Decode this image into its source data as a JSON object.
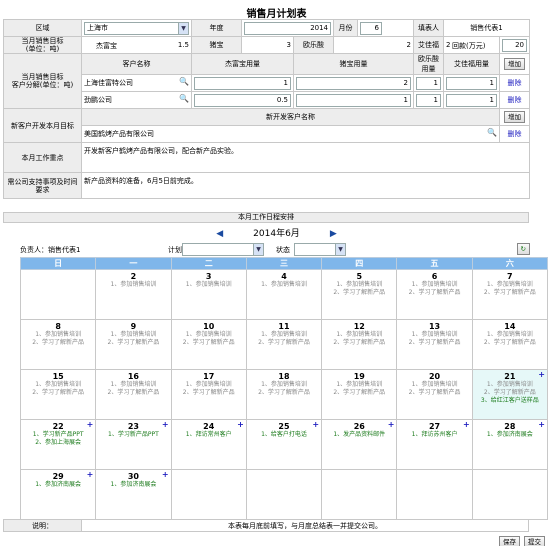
{
  "title": "销售月计划表",
  "form": {
    "region_label": "区域",
    "region_value": "上海市",
    "year_label": "年度",
    "year_value": "2014",
    "month_label": "月份",
    "month_value": "6",
    "reporter_label": "填表人",
    "reporter_value": "销售代表1",
    "target_label": "当月销售目标\n(单位：吨)",
    "products": [
      {
        "name": "杰富宝",
        "value": "1.5"
      },
      {
        "name": "猪宝",
        "value": "3"
      },
      {
        "name": "欧乐酸",
        "value": "2"
      },
      {
        "name": "艾佳福",
        "value": "2"
      }
    ],
    "payment_label": "回款(万元)",
    "payment_value": "20",
    "breakdown_label": "当月销售目标\n客户分解(单位：吨)",
    "breakdown_headers": [
      "客户名称",
      "杰富宝用量",
      "猪宝用量",
      "欧乐酸用量",
      "艾佳福用量"
    ],
    "add_label": "增加",
    "delete_label": "删除",
    "customers": [
      {
        "name": "上海佳富特公司",
        "v": [
          "1",
          "2",
          "1",
          "1"
        ]
      },
      {
        "name": "劲鹏公司",
        "v": [
          "0.5",
          "1",
          "1",
          "1"
        ]
      }
    ],
    "newcust_label": "新客户开发本月目标",
    "newcust_header": "新开发客户名称",
    "newcust_value": "美国鹤烤产品有限公司",
    "focus_label": "本月工作重点",
    "focus_value": "开发新客户鹤烤产品有限公司，配合新产品实验。",
    "support_label": "需公司支持事项及时间要求",
    "support_value": "新产品资料的准备，6月5日前完成。"
  },
  "schedule": {
    "title": "本月工作日程安排",
    "month": "2014年6月",
    "owner": "负责人：销售代表1",
    "plan_label": "计划",
    "status_label": "状态",
    "weekdays": [
      "日",
      "一",
      "二",
      "三",
      "四",
      "五",
      "六"
    ],
    "weeks": [
      [
        {
          "d": "",
          "e": []
        },
        {
          "d": "2",
          "e": [
            "1、参加销售培训"
          ]
        },
        {
          "d": "3",
          "e": [
            "1、参加销售培训"
          ]
        },
        {
          "d": "4",
          "e": [
            "1、参加销售培训"
          ]
        },
        {
          "d": "5",
          "e": [
            "1、参加销售培训",
            "2、学习了解新产品"
          ]
        },
        {
          "d": "6",
          "e": [
            "1、参加销售培训",
            "2、学习了解新产品"
          ]
        },
        {
          "d": "7",
          "e": [
            "1、参加销售培训",
            "2、学习了解新产品"
          ]
        }
      ],
      [
        {
          "d": "8",
          "e": [
            "1、参加销售培训",
            "2、学习了解新产品"
          ]
        },
        {
          "d": "9",
          "e": [
            "1、参加销售培训",
            "2、学习了解新产品"
          ]
        },
        {
          "d": "10",
          "e": [
            "1、参加销售培训",
            "2、学习了解新产品"
          ]
        },
        {
          "d": "11",
          "e": [
            "1、参加销售培训",
            "2、学习了解新产品"
          ]
        },
        {
          "d": "12",
          "e": [
            "1、参加销售培训",
            "2、学习了解新产品"
          ]
        },
        {
          "d": "13",
          "e": [
            "1、参加销售培训",
            "2、学习了解新产品"
          ]
        },
        {
          "d": "14",
          "e": [
            "1、参加销售培训",
            "2、学习了解新产品"
          ]
        }
      ],
      [
        {
          "d": "15",
          "e": [
            "1、参加销售培训",
            "2、学习了解新产品"
          ]
        },
        {
          "d": "16",
          "e": [
            "1、参加销售培训",
            "2、学习了解新产品"
          ]
        },
        {
          "d": "17",
          "e": [
            "1、参加销售培训",
            "2、学习了解新产品"
          ]
        },
        {
          "d": "18",
          "e": [
            "1、参加销售培训",
            "2、学习了解新产品"
          ]
        },
        {
          "d": "19",
          "e": [
            "1、参加销售培训",
            "2、学习了解新产品"
          ]
        },
        {
          "d": "20",
          "e": [
            "1、参加销售培训",
            "2、学习了解新产品"
          ]
        },
        {
          "d": "21",
          "e": [
            "1、参加销售培训",
            "2、学习了解新产品",
            "3、给红江客户送样品"
          ],
          "today": true
        }
      ],
      [
        {
          "d": "22",
          "e": [
            "1、学习新产品PPT",
            "2、参加上海展会"
          ],
          "g": true
        },
        {
          "d": "23",
          "e": [
            "1、学习新产品PPT"
          ],
          "g": true
        },
        {
          "d": "24",
          "e": [
            "1、拜访常州客户"
          ],
          "g": true
        },
        {
          "d": "25",
          "e": [
            "1、给客户打电话"
          ],
          "g": true
        },
        {
          "d": "26",
          "e": [
            "1、发产品资料邮件"
          ],
          "g": true
        },
        {
          "d": "27",
          "e": [
            "1、拜访苏州客户"
          ],
          "g": true
        },
        {
          "d": "28",
          "e": [
            "1、参加济南展会"
          ],
          "g": true
        }
      ],
      [
        {
          "d": "29",
          "e": [
            "1、参加济南展会"
          ],
          "g": true
        },
        {
          "d": "30",
          "e": [
            "1、参加济南展会"
          ],
          "g": true
        },
        {
          "d": "",
          "e": []
        },
        {
          "d": "",
          "e": []
        },
        {
          "d": "",
          "e": []
        },
        {
          "d": "",
          "e": []
        },
        {
          "d": "",
          "e": []
        }
      ]
    ]
  },
  "footer": {
    "note_label": "说明：",
    "note_value": "本表每月底前填写，与月度总结表一并提交公司。",
    "save": "保存",
    "submit": "提交"
  },
  "colors": {
    "header_blue": "#7fb6ea",
    "label_gray": "#ededed",
    "event_green": "#1a7a1a",
    "today_bg": "#e6f8f8"
  }
}
